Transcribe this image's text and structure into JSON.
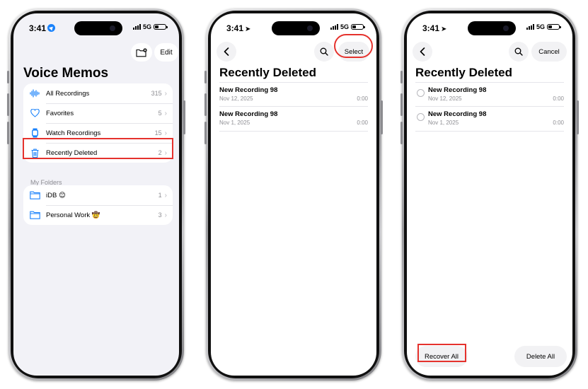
{
  "status": {
    "time": "3:41",
    "network": "5G"
  },
  "screen1": {
    "edit_label": "Edit",
    "title": "Voice Memos",
    "items": [
      {
        "label": "All Recordings",
        "count": "315",
        "icon": "waveform-icon"
      },
      {
        "label": "Favorites",
        "count": "5",
        "icon": "heart-icon"
      },
      {
        "label": "Watch Recordings",
        "count": "15",
        "icon": "watch-icon"
      },
      {
        "label": "Recently Deleted",
        "count": "2",
        "icon": "trash-icon"
      }
    ],
    "folders_label": "My Folders",
    "folders": [
      {
        "label": "iDB 😊",
        "count": "1"
      },
      {
        "label": "Personal Work 🤠",
        "count": "3"
      }
    ]
  },
  "screen2": {
    "select_label": "Select",
    "title": "Recently Deleted",
    "recordings": [
      {
        "name": "New Recording 98",
        "date": "Nov 12, 2025",
        "duration": "0:00"
      },
      {
        "name": "New Recording 98",
        "date": "Nov 1, 2025",
        "duration": "0:00"
      }
    ]
  },
  "screen3": {
    "cancel_label": "Cancel",
    "title": "Recently Deleted",
    "recordings": [
      {
        "name": "New Recording 98",
        "date": "Nov 12, 2025",
        "duration": "0:00"
      },
      {
        "name": "New Recording 98",
        "date": "Nov 1, 2025",
        "duration": "0:00"
      }
    ],
    "recover_all_label": "Recover All",
    "delete_all_label": "Delete All"
  },
  "colors": {
    "accent": "#1a82fb",
    "highlight": "#e5322d",
    "background": "#f2f2f7"
  }
}
